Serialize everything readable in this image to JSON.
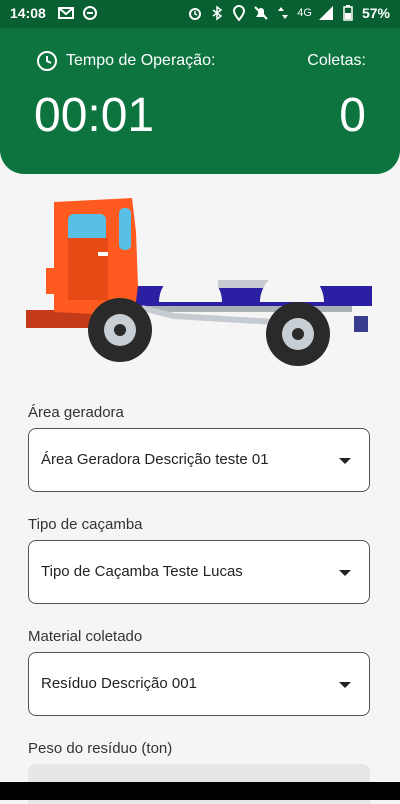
{
  "status_bar": {
    "time": "14:08",
    "left_icons": [
      "gmail-icon",
      "app-notification-icon"
    ],
    "right_icons": [
      "alarm-icon",
      "bluetooth-icon",
      "location-icon",
      "mute-icon",
      "data-arrows-icon"
    ],
    "network": "4G",
    "battery": "57%"
  },
  "header": {
    "operation_label": "Tempo de Operação:",
    "operation_value": "00:01",
    "coletas_label": "Coletas:",
    "coletas_value": "0"
  },
  "form": {
    "area": {
      "label": "Área geradora",
      "value": "Área Geradora Descrição teste 01"
    },
    "cacamba": {
      "label": "Tipo de caçamba",
      "value": "Tipo de Caçamba Teste Lucas"
    },
    "material": {
      "label": "Material coletado",
      "value": "Resíduo Descrição 001"
    },
    "peso": {
      "label": "Peso do resíduo (ton)",
      "value": ""
    }
  },
  "colors": {
    "header_green": "#0d7440",
    "status_green": "#085f31",
    "truck_cab": "#ff5a1f",
    "truck_bed": "#2b1fa3"
  }
}
